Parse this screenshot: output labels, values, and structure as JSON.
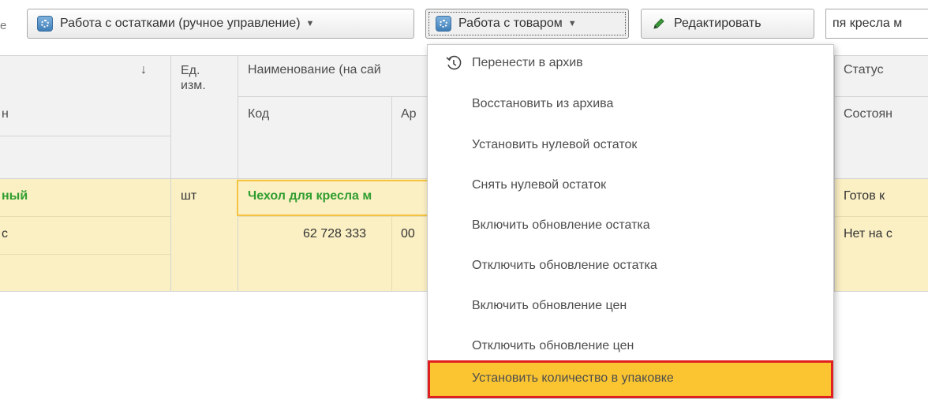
{
  "toolbar": {
    "left_fragment": "е",
    "remains_button": {
      "label": "Работа с остатками (ручное управление)",
      "icon": "gear-icon"
    },
    "goods_button": {
      "label": "Работа с товаром",
      "icon": "gear-icon"
    },
    "edit_button": {
      "label": "Редактировать",
      "icon": "pencil-icon"
    },
    "search_value": "пя кресла м"
  },
  "grid": {
    "headers": {
      "col_sort_arrow": "↓",
      "col_fragment_row2": "н",
      "unit": "Ед. изм.",
      "name": "Наименование (на сай",
      "code": "Код",
      "article": "Ар",
      "status": "Статус",
      "state": "Состоян"
    },
    "row": {
      "col1_line1": "ный",
      "col1_line2": "с",
      "unit": "шт",
      "name": "Чехол для кресла м",
      "code": "62 728 333",
      "article": "00",
      "status": "Готов к",
      "state": "Нет на с"
    }
  },
  "menu": {
    "items": [
      {
        "label": "Перенести в архив",
        "icon": "history-icon"
      },
      {
        "label": "Восстановить из архива"
      },
      {
        "label": "Установить нулевой остаток"
      },
      {
        "label": "Снять нулевой остаток"
      },
      {
        "label": "Включить обновление остатка"
      },
      {
        "label": "Отключить обновление остатка"
      },
      {
        "label": "Включить обновление цен"
      },
      {
        "label": "Отключить обновление цен"
      },
      {
        "label": "Установить количество в упаковке"
      }
    ],
    "highlighted_index": 8
  },
  "colors": {
    "row_highlight": "#fbf0c4",
    "name_text_green": "#2f9e2f",
    "menu_highlight": "#fbc531",
    "menu_highlight_border": "#e02020"
  }
}
